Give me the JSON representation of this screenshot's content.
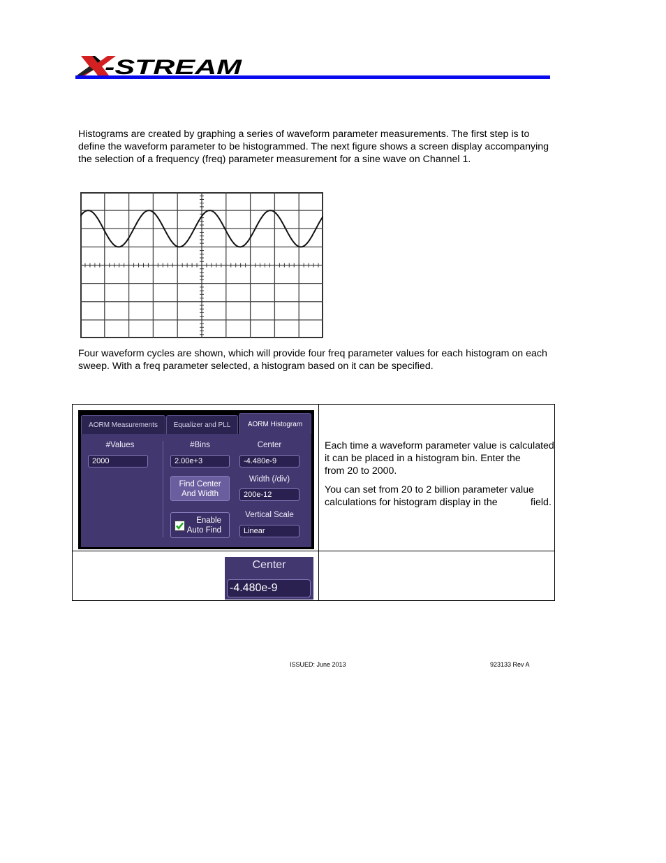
{
  "header": {
    "logo_text": "X-STREAM",
    "logo_colors": {
      "x_accent": "#d42020",
      "text": "#000000",
      "rule": "#0a0aee"
    }
  },
  "body": {
    "paragraph1": "Histograms are created by graphing a series of waveform parameter measurements. The first step is to define the waveform parameter to be histogrammed. The next figure shows a screen display accompanying the selection of a frequency (freq) parameter measurement for a sine wave on Channel 1.",
    "paragraph2": "Four waveform cycles are shown, which will provide four freq parameter values for each histogram on each sweep. With a freq parameter selected, a histogram based on it can be specified."
  },
  "scope_figure": {
    "divisions_horizontal": 10,
    "divisions_vertical": 8,
    "waveform": "sine",
    "cycles_visible": 4
  },
  "dialog": {
    "tabs": [
      {
        "label": "AORM Measurements",
        "active": false
      },
      {
        "label": "Equalizer and PLL",
        "active": false
      },
      {
        "label": "AORM Histogram",
        "active": true
      }
    ],
    "values_label": "#Values",
    "values_value": "2000",
    "bins_label": "#Bins",
    "bins_value": "2.00e+3",
    "center_label": "Center",
    "center_value": "-4.480e-9",
    "find_button": "Find Center And Width",
    "find_button_line1": "Find Center",
    "find_button_line2": "And Width",
    "width_label": "Width (/div)",
    "width_value": "200e-12",
    "auto_find_line1": "Enable",
    "auto_find_line2": "Auto Find",
    "auto_find_checked": true,
    "vscale_label": "Vertical Scale",
    "vscale_value": "Linear",
    "colors": {
      "panel": "#42376f",
      "field": "#2a2150",
      "button": "#6b5e9f",
      "check": "#22aa22"
    }
  },
  "table_text": {
    "text1": "Each time a waveform parameter value is calculated it can be placed in a histogram bin. Enter the          from 20 to 2000.",
    "text2": "You can set from 20 to 2 billion parameter value calculations for histogram display in the            field."
  },
  "center_zoom": {
    "label": "Center",
    "value": "-4.480e-9"
  },
  "footer": {
    "issued": "ISSUED: June 2013",
    "doc_number": "923133 Rev A"
  }
}
